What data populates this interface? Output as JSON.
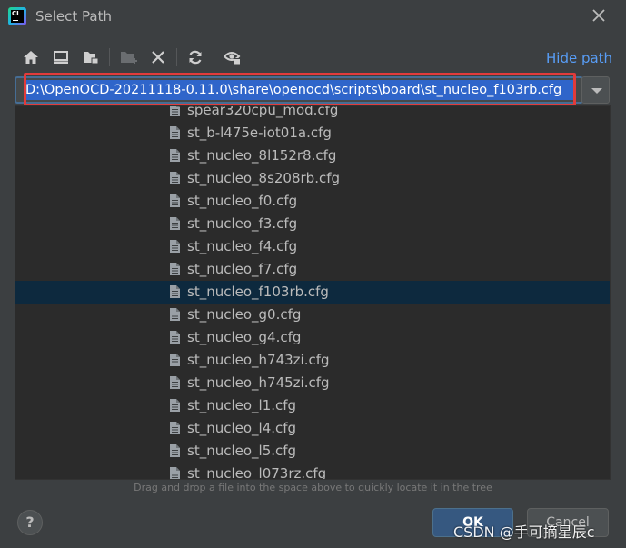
{
  "window": {
    "title": "Select Path",
    "app_icon_text": "CL"
  },
  "toolbar": {
    "icons": [
      "home-icon",
      "desktop-icon",
      "project-folder-icon",
      "new-folder-icon",
      "delete-icon",
      "refresh-icon",
      "show-hidden-icon"
    ],
    "hide_path_label": "Hide path"
  },
  "path": {
    "value": "D:\\OpenOCD-20211118-0.11.0\\share\\openocd\\scripts\\board\\st_nucleo_f103rb.cfg"
  },
  "files": [
    {
      "name": "spear320cpu_mod.cfg",
      "selected": false
    },
    {
      "name": "st_b-l475e-iot01a.cfg",
      "selected": false
    },
    {
      "name": "st_nucleo_8l152r8.cfg",
      "selected": false
    },
    {
      "name": "st_nucleo_8s208rb.cfg",
      "selected": false
    },
    {
      "name": "st_nucleo_f0.cfg",
      "selected": false
    },
    {
      "name": "st_nucleo_f3.cfg",
      "selected": false
    },
    {
      "name": "st_nucleo_f4.cfg",
      "selected": false
    },
    {
      "name": "st_nucleo_f7.cfg",
      "selected": false
    },
    {
      "name": "st_nucleo_f103rb.cfg",
      "selected": true
    },
    {
      "name": "st_nucleo_g0.cfg",
      "selected": false
    },
    {
      "name": "st_nucleo_g4.cfg",
      "selected": false
    },
    {
      "name": "st_nucleo_h743zi.cfg",
      "selected": false
    },
    {
      "name": "st_nucleo_h745zi.cfg",
      "selected": false
    },
    {
      "name": "st_nucleo_l1.cfg",
      "selected": false
    },
    {
      "name": "st_nucleo_l4.cfg",
      "selected": false
    },
    {
      "name": "st_nucleo_l5.cfg",
      "selected": false
    },
    {
      "name": "st_nucleo_l073rz.cfg",
      "selected": false
    }
  ],
  "hint": "Drag and drop a file into the space above to quickly locate it in the tree",
  "buttons": {
    "help": "?",
    "ok": "OK",
    "cancel": "Cancel"
  },
  "watermark": "CSDN @手可摘星辰c",
  "colors": {
    "background": "#3c3f41",
    "tree_background": "#2b2b2b",
    "selection": "#0d293e",
    "link": "#589df6",
    "path_highlight": "#2f65ca",
    "annotation_box": "#e23b3b"
  }
}
